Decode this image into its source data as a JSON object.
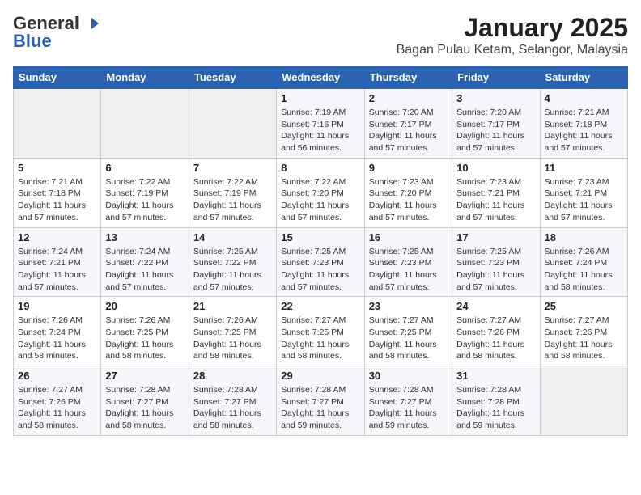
{
  "header": {
    "logo_general": "General",
    "logo_blue": "Blue",
    "title": "January 2025",
    "subtitle": "Bagan Pulau Ketam, Selangor, Malaysia"
  },
  "weekdays": [
    "Sunday",
    "Monday",
    "Tuesday",
    "Wednesday",
    "Thursday",
    "Friday",
    "Saturday"
  ],
  "weeks": [
    [
      {
        "day": "",
        "sunrise": "",
        "sunset": "",
        "daylight": ""
      },
      {
        "day": "",
        "sunrise": "",
        "sunset": "",
        "daylight": ""
      },
      {
        "day": "",
        "sunrise": "",
        "sunset": "",
        "daylight": ""
      },
      {
        "day": "1",
        "sunrise": "Sunrise: 7:19 AM",
        "sunset": "Sunset: 7:16 PM",
        "daylight": "Daylight: 11 hours and 56 minutes."
      },
      {
        "day": "2",
        "sunrise": "Sunrise: 7:20 AM",
        "sunset": "Sunset: 7:17 PM",
        "daylight": "Daylight: 11 hours and 57 minutes."
      },
      {
        "day": "3",
        "sunrise": "Sunrise: 7:20 AM",
        "sunset": "Sunset: 7:17 PM",
        "daylight": "Daylight: 11 hours and 57 minutes."
      },
      {
        "day": "4",
        "sunrise": "Sunrise: 7:21 AM",
        "sunset": "Sunset: 7:18 PM",
        "daylight": "Daylight: 11 hours and 57 minutes."
      }
    ],
    [
      {
        "day": "5",
        "sunrise": "Sunrise: 7:21 AM",
        "sunset": "Sunset: 7:18 PM",
        "daylight": "Daylight: 11 hours and 57 minutes."
      },
      {
        "day": "6",
        "sunrise": "Sunrise: 7:22 AM",
        "sunset": "Sunset: 7:19 PM",
        "daylight": "Daylight: 11 hours and 57 minutes."
      },
      {
        "day": "7",
        "sunrise": "Sunrise: 7:22 AM",
        "sunset": "Sunset: 7:19 PM",
        "daylight": "Daylight: 11 hours and 57 minutes."
      },
      {
        "day": "8",
        "sunrise": "Sunrise: 7:22 AM",
        "sunset": "Sunset: 7:20 PM",
        "daylight": "Daylight: 11 hours and 57 minutes."
      },
      {
        "day": "9",
        "sunrise": "Sunrise: 7:23 AM",
        "sunset": "Sunset: 7:20 PM",
        "daylight": "Daylight: 11 hours and 57 minutes."
      },
      {
        "day": "10",
        "sunrise": "Sunrise: 7:23 AM",
        "sunset": "Sunset: 7:21 PM",
        "daylight": "Daylight: 11 hours and 57 minutes."
      },
      {
        "day": "11",
        "sunrise": "Sunrise: 7:23 AM",
        "sunset": "Sunset: 7:21 PM",
        "daylight": "Daylight: 11 hours and 57 minutes."
      }
    ],
    [
      {
        "day": "12",
        "sunrise": "Sunrise: 7:24 AM",
        "sunset": "Sunset: 7:21 PM",
        "daylight": "Daylight: 11 hours and 57 minutes."
      },
      {
        "day": "13",
        "sunrise": "Sunrise: 7:24 AM",
        "sunset": "Sunset: 7:22 PM",
        "daylight": "Daylight: 11 hours and 57 minutes."
      },
      {
        "day": "14",
        "sunrise": "Sunrise: 7:25 AM",
        "sunset": "Sunset: 7:22 PM",
        "daylight": "Daylight: 11 hours and 57 minutes."
      },
      {
        "day": "15",
        "sunrise": "Sunrise: 7:25 AM",
        "sunset": "Sunset: 7:23 PM",
        "daylight": "Daylight: 11 hours and 57 minutes."
      },
      {
        "day": "16",
        "sunrise": "Sunrise: 7:25 AM",
        "sunset": "Sunset: 7:23 PM",
        "daylight": "Daylight: 11 hours and 57 minutes."
      },
      {
        "day": "17",
        "sunrise": "Sunrise: 7:25 AM",
        "sunset": "Sunset: 7:23 PM",
        "daylight": "Daylight: 11 hours and 57 minutes."
      },
      {
        "day": "18",
        "sunrise": "Sunrise: 7:26 AM",
        "sunset": "Sunset: 7:24 PM",
        "daylight": "Daylight: 11 hours and 58 minutes."
      }
    ],
    [
      {
        "day": "19",
        "sunrise": "Sunrise: 7:26 AM",
        "sunset": "Sunset: 7:24 PM",
        "daylight": "Daylight: 11 hours and 58 minutes."
      },
      {
        "day": "20",
        "sunrise": "Sunrise: 7:26 AM",
        "sunset": "Sunset: 7:25 PM",
        "daylight": "Daylight: 11 hours and 58 minutes."
      },
      {
        "day": "21",
        "sunrise": "Sunrise: 7:26 AM",
        "sunset": "Sunset: 7:25 PM",
        "daylight": "Daylight: 11 hours and 58 minutes."
      },
      {
        "day": "22",
        "sunrise": "Sunrise: 7:27 AM",
        "sunset": "Sunset: 7:25 PM",
        "daylight": "Daylight: 11 hours and 58 minutes."
      },
      {
        "day": "23",
        "sunrise": "Sunrise: 7:27 AM",
        "sunset": "Sunset: 7:25 PM",
        "daylight": "Daylight: 11 hours and 58 minutes."
      },
      {
        "day": "24",
        "sunrise": "Sunrise: 7:27 AM",
        "sunset": "Sunset: 7:26 PM",
        "daylight": "Daylight: 11 hours and 58 minutes."
      },
      {
        "day": "25",
        "sunrise": "Sunrise: 7:27 AM",
        "sunset": "Sunset: 7:26 PM",
        "daylight": "Daylight: 11 hours and 58 minutes."
      }
    ],
    [
      {
        "day": "26",
        "sunrise": "Sunrise: 7:27 AM",
        "sunset": "Sunset: 7:26 PM",
        "daylight": "Daylight: 11 hours and 58 minutes."
      },
      {
        "day": "27",
        "sunrise": "Sunrise: 7:28 AM",
        "sunset": "Sunset: 7:27 PM",
        "daylight": "Daylight: 11 hours and 58 minutes."
      },
      {
        "day": "28",
        "sunrise": "Sunrise: 7:28 AM",
        "sunset": "Sunset: 7:27 PM",
        "daylight": "Daylight: 11 hours and 58 minutes."
      },
      {
        "day": "29",
        "sunrise": "Sunrise: 7:28 AM",
        "sunset": "Sunset: 7:27 PM",
        "daylight": "Daylight: 11 hours and 59 minutes."
      },
      {
        "day": "30",
        "sunrise": "Sunrise: 7:28 AM",
        "sunset": "Sunset: 7:27 PM",
        "daylight": "Daylight: 11 hours and 59 minutes."
      },
      {
        "day": "31",
        "sunrise": "Sunrise: 7:28 AM",
        "sunset": "Sunset: 7:28 PM",
        "daylight": "Daylight: 11 hours and 59 minutes."
      },
      {
        "day": "",
        "sunrise": "",
        "sunset": "",
        "daylight": ""
      }
    ]
  ]
}
